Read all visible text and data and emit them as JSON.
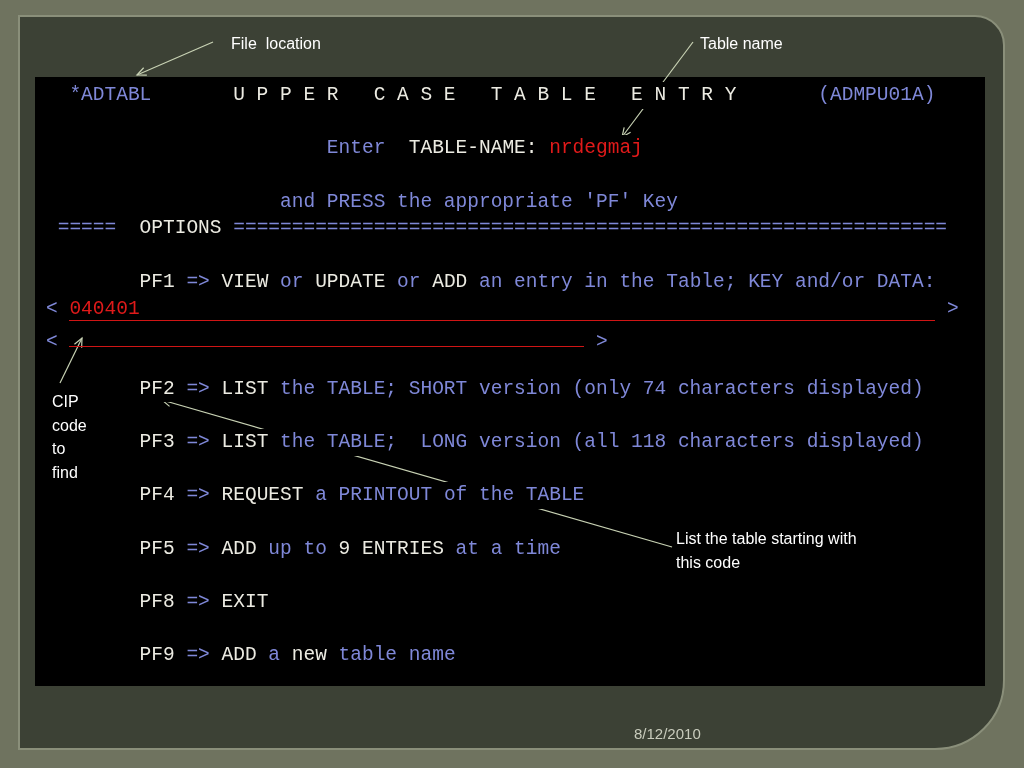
{
  "annotations": [
    {
      "text": "File  location"
    },
    {
      "text": "Table name"
    },
    {
      "text": "CIP code to find"
    },
    {
      "text": "List the table starting with this code"
    }
  ],
  "terminal": {
    "header": {
      "file": "*ADTABL",
      "title": "U P P E R   C A S E   T A B L E   E N T R Y",
      "program": "(ADMPU01A)"
    },
    "prompt": [
      {
        "text": "Enter",
        "kind": "text"
      },
      {
        "text": "TABLE-NAME:",
        "kind": "label"
      },
      {
        "text": "nrdegmaj",
        "kind": "value"
      }
    ],
    "instruction": "and PRESS the appropriate 'PF' Key",
    "options_rule": [
      {
        "text": "=====",
        "kind": "text"
      },
      {
        "text": "OPTIONS",
        "kind": "label"
      },
      {
        "text": "=============================================================",
        "kind": "text"
      }
    ],
    "options": [
      {
        "key": "PF1",
        "arrow": "=>",
        "parts": [
          {
            "text": "VIEW",
            "kind": "label"
          },
          {
            "text": "or",
            "kind": "text"
          },
          {
            "text": "UPDATE",
            "kind": "label"
          },
          {
            "text": "or",
            "kind": "text"
          },
          {
            "text": "ADD",
            "kind": "label"
          },
          {
            "text": "an entry in the Table; KEY and/or DATA:",
            "kind": "text"
          }
        ]
      },
      {
        "key": "PF2",
        "arrow": "=>",
        "parts": [
          {
            "text": "LIST",
            "kind": "label"
          },
          {
            "text": "the TABLE; SHORT version (only 74 characters displayed)",
            "kind": "text"
          }
        ]
      },
      {
        "key": "PF3",
        "arrow": "=>",
        "parts": [
          {
            "text": "LIST",
            "kind": "label"
          },
          {
            "text": "the TABLE;  LONG version (all 118 characters displayed)",
            "kind": "text"
          }
        ]
      },
      {
        "key": "PF4",
        "arrow": "=>",
        "parts": [
          {
            "text": "REQUEST",
            "kind": "label"
          },
          {
            "text": "a PRINTOUT of the TABLE",
            "kind": "text"
          }
        ]
      },
      {
        "key": "PF5",
        "arrow": "=>",
        "parts": [
          {
            "text": "ADD",
            "kind": "label"
          },
          {
            "text": "up to",
            "kind": "text"
          },
          {
            "text": "9 ENTRIES",
            "kind": "label"
          },
          {
            "text": "at a time",
            "kind": "text"
          }
        ]
      },
      {
        "key": "PF8",
        "arrow": "=>",
        "parts": [
          {
            "text": "EXIT",
            "kind": "label"
          }
        ]
      },
      {
        "key": "PF9",
        "arrow": "=>",
        "parts": [
          {
            "text": "ADD",
            "kind": "label"
          },
          {
            "text": "a",
            "kind": "text"
          },
          {
            "text": "new",
            "kind": "label"
          },
          {
            "text": "table name",
            "kind": "text"
          }
        ]
      }
    ],
    "key_fields": [
      {
        "open": "<",
        "value": "040401",
        "close": ">"
      },
      {
        "open": "<",
        "close": ">"
      }
    ]
  },
  "date": "8/12/2010"
}
